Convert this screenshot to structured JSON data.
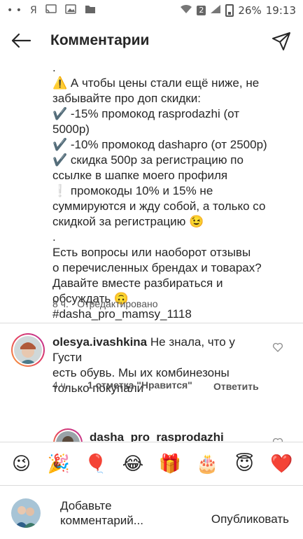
{
  "status_bar": {
    "carrier": "Я",
    "sim": "2",
    "battery": "26%",
    "time": "19:13"
  },
  "header": {
    "title": "Комментарии"
  },
  "caption": {
    "lines": [
      ".",
      "⚠️ А чтобы цены стали ещё ниже, не",
      "забывайте про доп скидки:",
      "✔️ -15% промокод rasprodazhi (от",
      "5000р)",
      "✔️ -10% промокод dashapro (от 2500р)",
      "✔️ скидка 500р за регистрацию по",
      "ссылке в шапке моего профиля",
      "❕ промокоды 10% и 15% не",
      "суммируются и жду собой, а только со",
      "скидкой за регистрацию 😉",
      ".",
      "Есть вопросы или наоборот отзывы",
      "о перечисленных брендах и товарах?",
      "Давайте вместе разбираться и",
      "обсуждать 🙃",
      "#dasha_pro_mamsy_1118"
    ],
    "meta": "8 ч. · Отредактировано"
  },
  "comments": [
    {
      "username": "olesya.ivashkina",
      "text_first": " Не знала, что у Густи",
      "text_rest": [
        "есть обувь. Мы их комбинезоны",
        "только покупали"
      ],
      "time": "4 ч.",
      "likes": "1 отметка \"Нравится\"",
      "reply": "Ответить"
    },
    {
      "username": "dasha_pro_rasprodazhi"
    }
  ],
  "emoji_bar": [
    "😉",
    "🎉",
    "🎈",
    "😂",
    "🎁",
    "🎂",
    "😇",
    "❤️"
  ],
  "input": {
    "placeholder": "Добавьте комментарий...",
    "publish": "Опубликовать"
  }
}
